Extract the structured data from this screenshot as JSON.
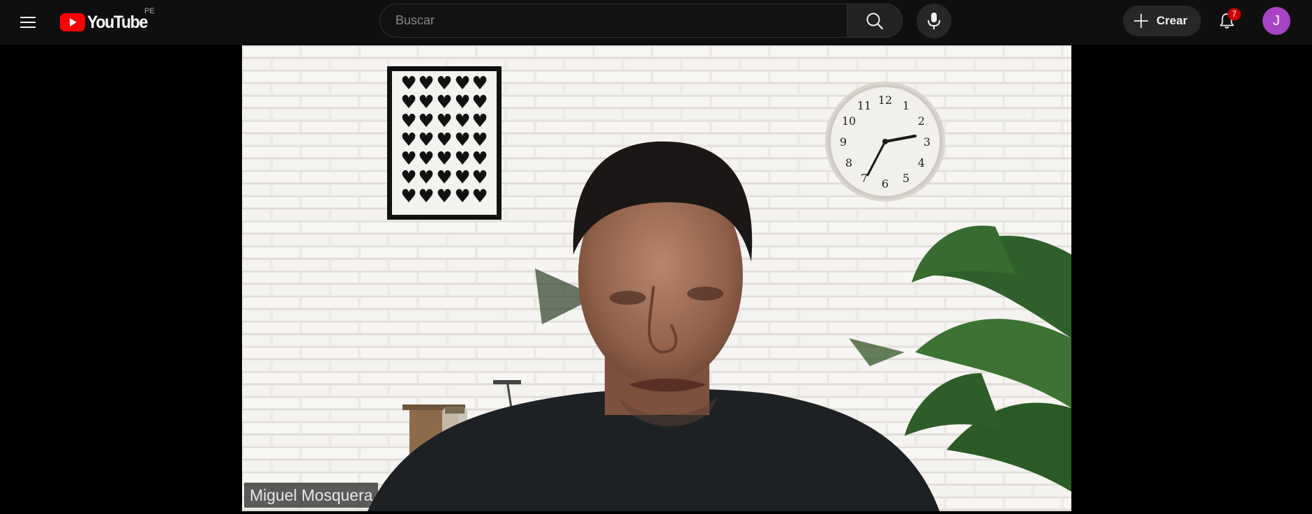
{
  "masthead": {
    "logo_text": "YouTube",
    "country_code": "PE",
    "search": {
      "placeholder": "Buscar",
      "value": ""
    },
    "create_label": "Crear",
    "notifications_count": "7",
    "avatar_initial": "J"
  },
  "player": {
    "participant_name": "Miguel Mosquera",
    "clock_numbers": [
      "12",
      "1",
      "2",
      "3",
      "4",
      "5",
      "6",
      "7",
      "8",
      "9",
      "10",
      "11"
    ]
  },
  "colors": {
    "brand_red": "#ff0000",
    "avatar_bg": "#a845c4",
    "badge_red": "#cc0000",
    "background": "#0f0f0f"
  },
  "icons": {
    "menu": "hamburger-menu-icon",
    "logo": "youtube-play-icon",
    "search": "search-icon",
    "mic": "microphone-icon",
    "create": "plus-icon",
    "notifications": "bell-icon"
  }
}
